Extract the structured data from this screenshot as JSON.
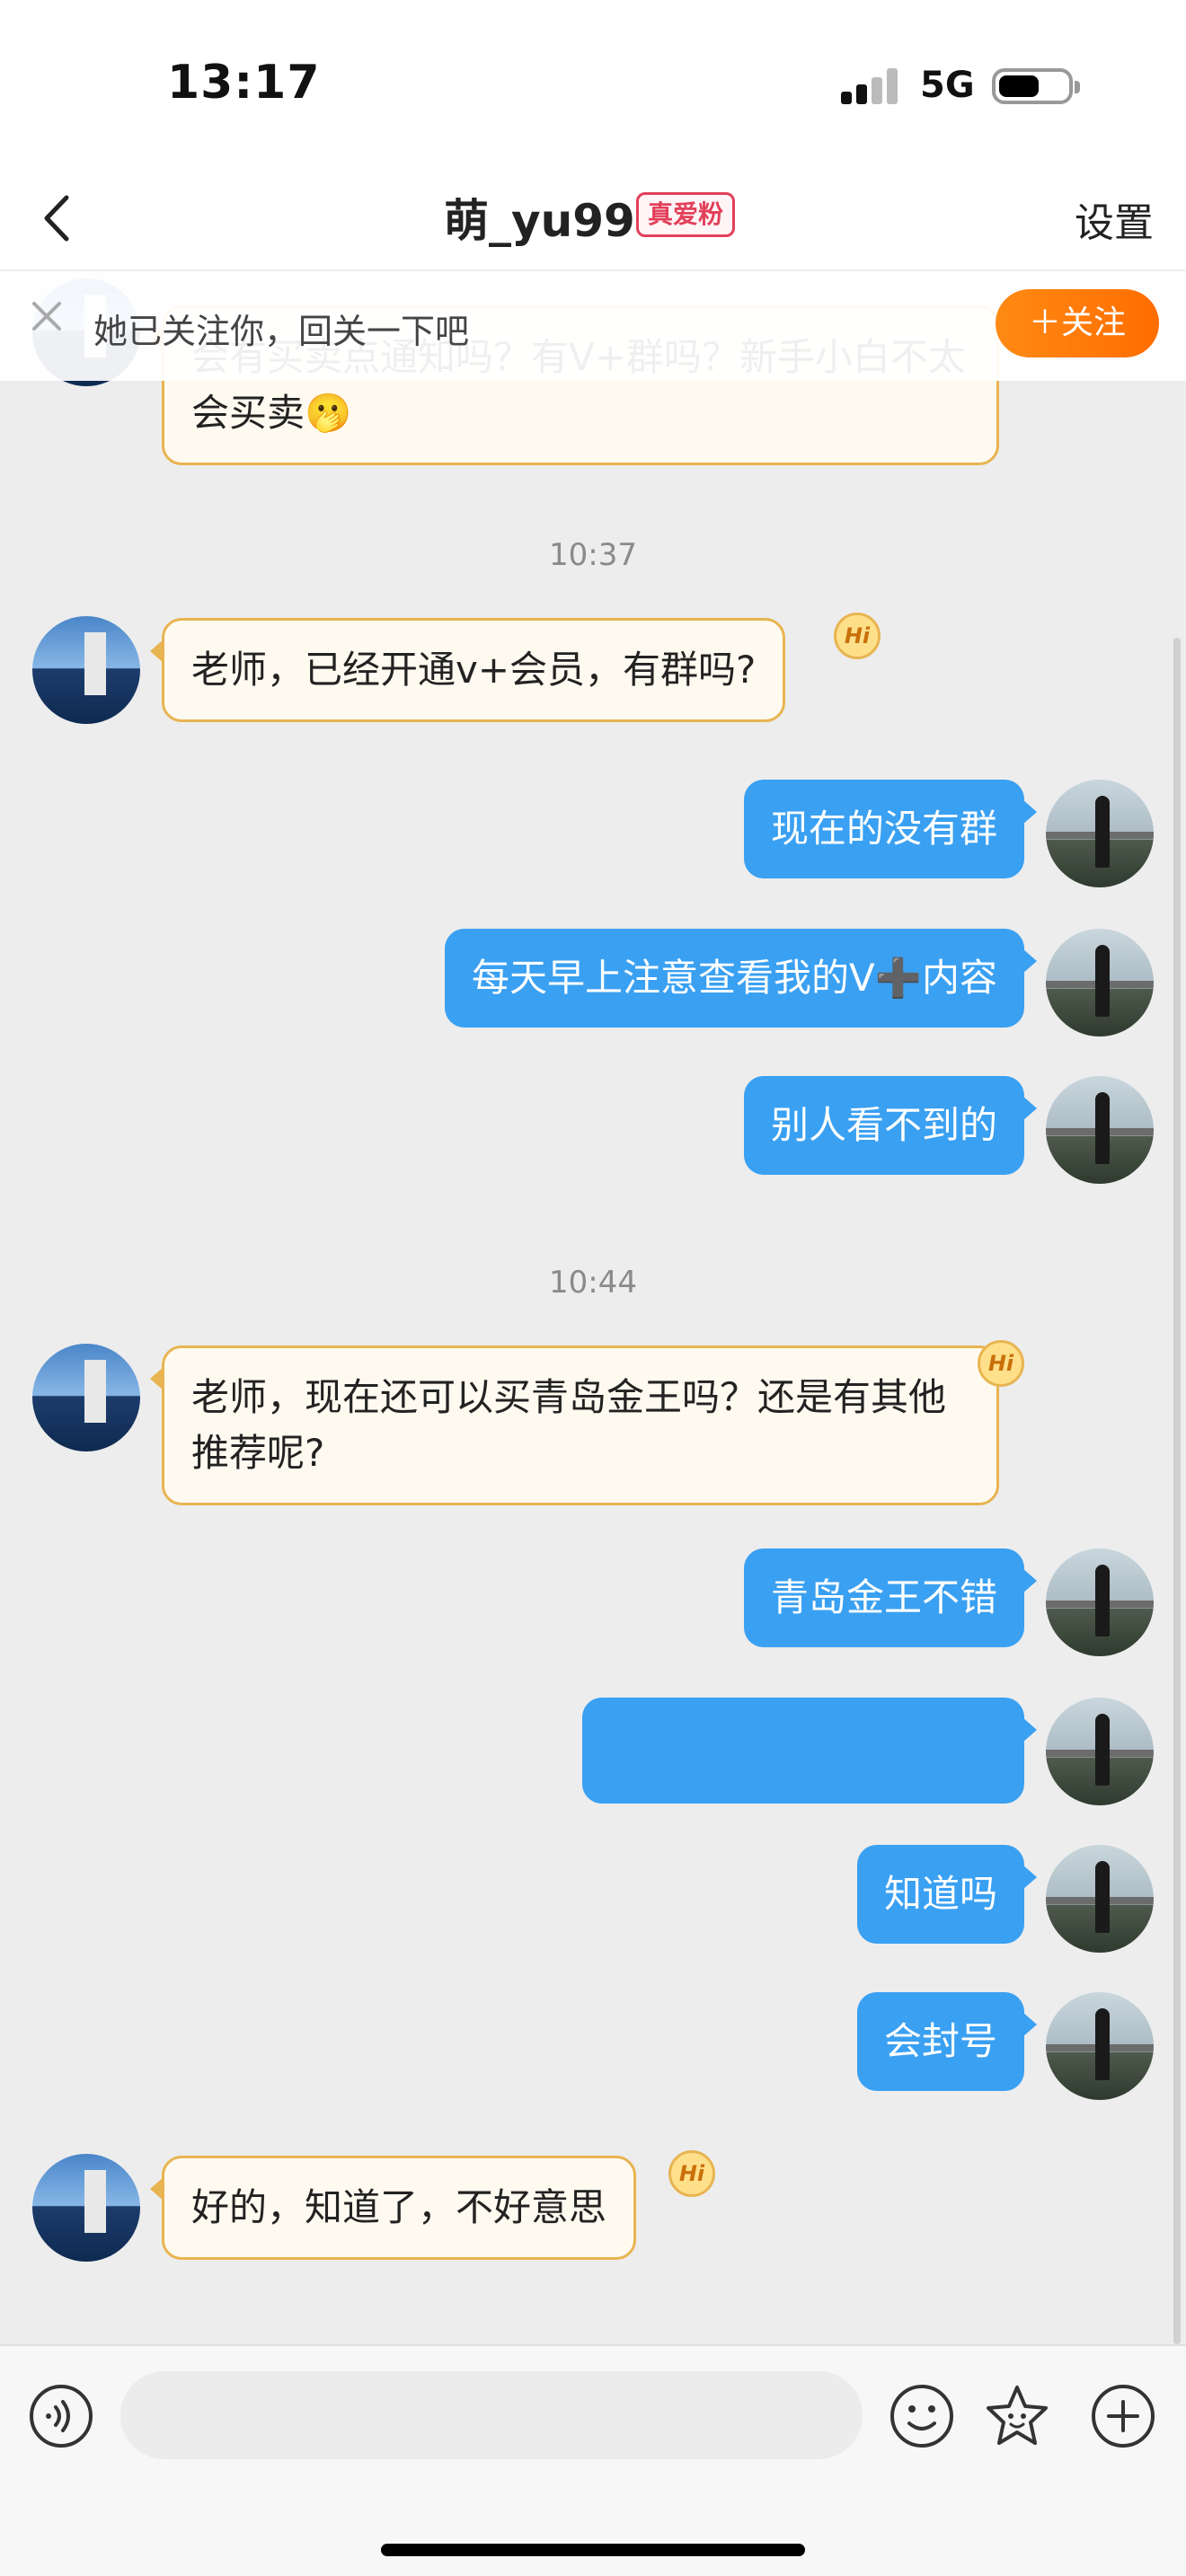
{
  "status_bar": {
    "time": "13:17",
    "network": "5G"
  },
  "header": {
    "title": "萌_yu99",
    "fan_badge": "真爱粉",
    "settings_label": "设置"
  },
  "follow_banner": {
    "text": "她已关注你，回关一下吧",
    "button_label": "＋关注"
  },
  "messages": {
    "m0": "会有买卖点通知吗？有V+群吗？新手小白不太会买卖🫢",
    "t1": "10:37",
    "m1": "老师，已经开通v+会员，有群吗?",
    "m2": "现在的没有群",
    "m3": "每天早上注意查看我的V➕内容",
    "m4": "别人看不到的",
    "t2": "10:44",
    "m5": "老师，现在还可以买青岛金王吗？还是有其他推荐呢?",
    "m6": "青岛金王不错",
    "m7": "",
    "m8": "知道吗",
    "m9": "会封号",
    "m10": "好的，知道了，不好意思"
  },
  "badges": {
    "hi": "Hi"
  },
  "input": {
    "placeholder": ""
  },
  "colors": {
    "outgoing_bubble": "#3aa0f2",
    "incoming_bubble": "#fffaf0",
    "incoming_border": "#e8b451",
    "follow_button": "#ff7a00",
    "fan_badge": "#e2405a"
  }
}
